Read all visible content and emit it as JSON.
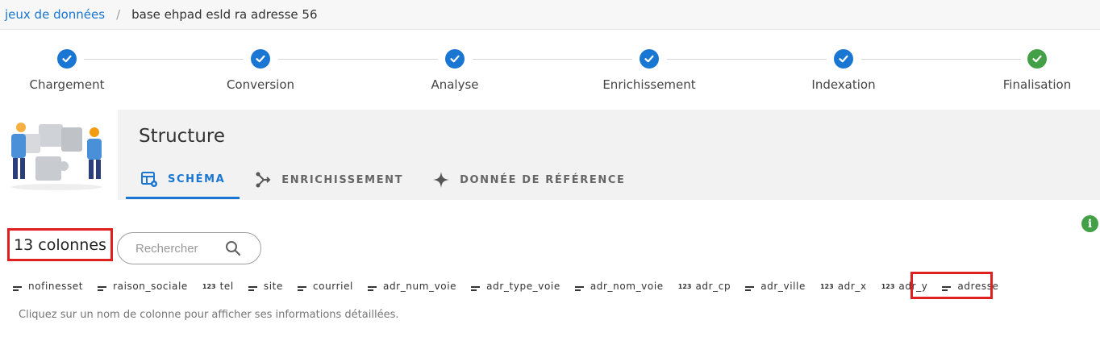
{
  "breadcrumb": {
    "root": "jeux de données",
    "separator": "/",
    "current": "base ehpad esld ra adresse 56"
  },
  "stepper": {
    "steps": [
      {
        "label": "Chargement",
        "status": "done"
      },
      {
        "label": "Conversion",
        "status": "done"
      },
      {
        "label": "Analyse",
        "status": "done"
      },
      {
        "label": "Enrichissement",
        "status": "done"
      },
      {
        "label": "Indexation",
        "status": "done"
      },
      {
        "label": "Finalisation",
        "status": "complete"
      }
    ],
    "colors": {
      "done": "#1976d2",
      "complete": "#43a047"
    }
  },
  "section": {
    "title": "Structure",
    "tabs": [
      {
        "label": "SCHÉMA",
        "icon": "table-settings-icon",
        "active": true
      },
      {
        "label": "ENRICHISSEMENT",
        "icon": "merge-arrows-icon",
        "active": false
      },
      {
        "label": "DONNÉE DE RÉFÉRENCE",
        "icon": "sparkle-icon",
        "active": false
      }
    ]
  },
  "schema": {
    "count_label": "13 colonnes",
    "search_placeholder": "Rechercher",
    "info_icon": "i",
    "columns": [
      {
        "name": "nofinesset",
        "type": "text"
      },
      {
        "name": "raison_sociale",
        "type": "text"
      },
      {
        "name": "tel",
        "type": "number"
      },
      {
        "name": "site",
        "type": "text"
      },
      {
        "name": "courriel",
        "type": "text"
      },
      {
        "name": "adr_num_voie",
        "type": "text"
      },
      {
        "name": "adr_type_voie",
        "type": "text"
      },
      {
        "name": "adr_nom_voie",
        "type": "text"
      },
      {
        "name": "adr_cp",
        "type": "number"
      },
      {
        "name": "adr_ville",
        "type": "text"
      },
      {
        "name": "adr_x",
        "type": "number"
      },
      {
        "name": "adr_y",
        "type": "number"
      },
      {
        "name": "adresse",
        "type": "text"
      }
    ],
    "number_type_glyph": "123",
    "hint": "Cliquez sur un nom de colonne pour afficher ses informations détaillées."
  },
  "accent": "#1976d2",
  "highlight_color": "#e01f1f"
}
